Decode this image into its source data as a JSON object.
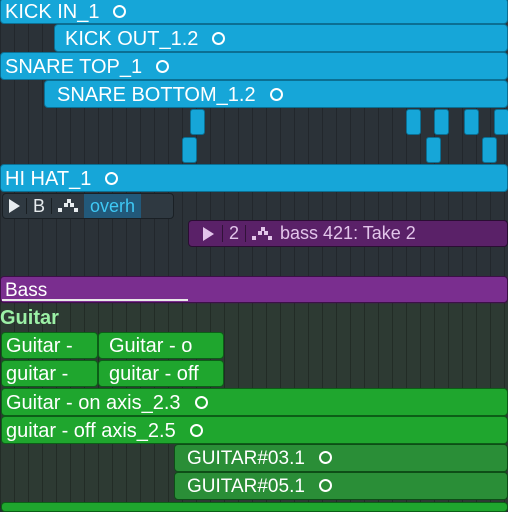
{
  "tracks": {
    "kick_in": {
      "label": "KICK IN_1"
    },
    "kick_out": {
      "label": "KICK OUT_1.2"
    },
    "snare_top": {
      "label": "SNARE TOP_1"
    },
    "snare_bottom": {
      "label": "SNARE BOTTOM_1.2"
    },
    "hi_hat": {
      "label": "HI HAT_1"
    },
    "overhead_toolbar": {
      "b_label": "B",
      "name": "overh"
    },
    "bass_take": {
      "number": "2",
      "name": "bass 421: Take 2"
    },
    "bass": {
      "label": "Bass"
    },
    "guitar_header": {
      "label": "Guitar"
    },
    "guitar_regions": {
      "on_small": "Guitar  -",
      "on_small_2": "Guitar  - o",
      "off_small": "guitar -",
      "off_small_2": "guitar - off",
      "on_axis": "Guitar  - on axis_2.3",
      "off_axis": "guitar - off axis_2.5",
      "g03": "GUITAR#03.1",
      "g05": "GUITAR#05.1"
    }
  },
  "colors": {
    "drums": "#16a6d8",
    "bass": "#7a2e8f",
    "guitar": "#1fa62e",
    "guitar_dark": "#2a8e37",
    "overhead_toolbar_bg": "#2f3941",
    "overhead_name": "#3ec8f5",
    "bass_take_bg": "#5a2168",
    "guitar_header_text": "#9cf0a6"
  },
  "icons": [
    "loop-circle-icon",
    "play-icon",
    "bars-icon"
  ]
}
